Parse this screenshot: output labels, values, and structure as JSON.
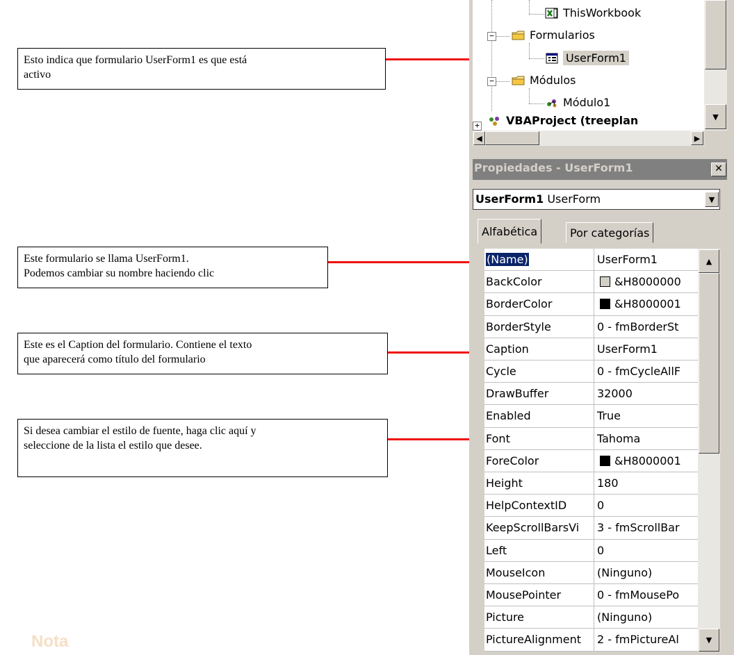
{
  "callouts": [
    {
      "text": "Esto indica que formulario UserForm1 es que está\nactivo"
    },
    {
      "text": "Este formulario se llama UserForm1.\nPodemos cambiar su nombre haciendo clic"
    },
    {
      "text": "Este es el Caption del formulario. Contiene el texto\nque aparecerá como título del formulario"
    },
    {
      "text": "Si desea cambiar el estilo de fuente, haga clic aquí y\nseleccione de la lista el estilo que desee."
    }
  ],
  "nota": "Nota",
  "tree": {
    "items": [
      {
        "label": "ThisWorkbook"
      },
      {
        "label": "Formularios"
      },
      {
        "label": "UserForm1"
      },
      {
        "label": "Módulos"
      },
      {
        "label": "Módulo1"
      },
      {
        "label": "VBAProject (treeplan"
      }
    ]
  },
  "properties": {
    "title": "Propiedades - UserForm1",
    "object_name": "UserForm1",
    "object_type": "UserForm",
    "tabs": [
      "Alfabética",
      "Por categorías"
    ],
    "rows": [
      {
        "name": "(Name)",
        "value": "UserForm1",
        "selected": true
      },
      {
        "name": "BackColor",
        "value": "&H8000000",
        "swatch": "#d4d0c8"
      },
      {
        "name": "BorderColor",
        "value": "&H8000001",
        "swatch": "#000000"
      },
      {
        "name": "BorderStyle",
        "value": "0 - fmBorderSt"
      },
      {
        "name": "Caption",
        "value": "UserForm1"
      },
      {
        "name": "Cycle",
        "value": "0 - fmCycleAllF"
      },
      {
        "name": "DrawBuffer",
        "value": "32000"
      },
      {
        "name": "Enabled",
        "value": "True"
      },
      {
        "name": "Font",
        "value": "Tahoma"
      },
      {
        "name": "ForeColor",
        "value": "&H8000001",
        "swatch": "#000000"
      },
      {
        "name": "Height",
        "value": "180"
      },
      {
        "name": "HelpContextID",
        "value": "0"
      },
      {
        "name": "KeepScrollBarsVi",
        "value": "3 - fmScrollBar"
      },
      {
        "name": "Left",
        "value": "0"
      },
      {
        "name": "MouseIcon",
        "value": "(Ninguno)"
      },
      {
        "name": "MousePointer",
        "value": "0 - fmMousePo"
      },
      {
        "name": "Picture",
        "value": "(Ninguno)"
      },
      {
        "name": "PictureAlignment",
        "value": "2 - fmPictureAl"
      }
    ]
  },
  "colors": {
    "arrow": "#f01010",
    "selection": "#0a246a",
    "panel": "#d4d0c8"
  }
}
